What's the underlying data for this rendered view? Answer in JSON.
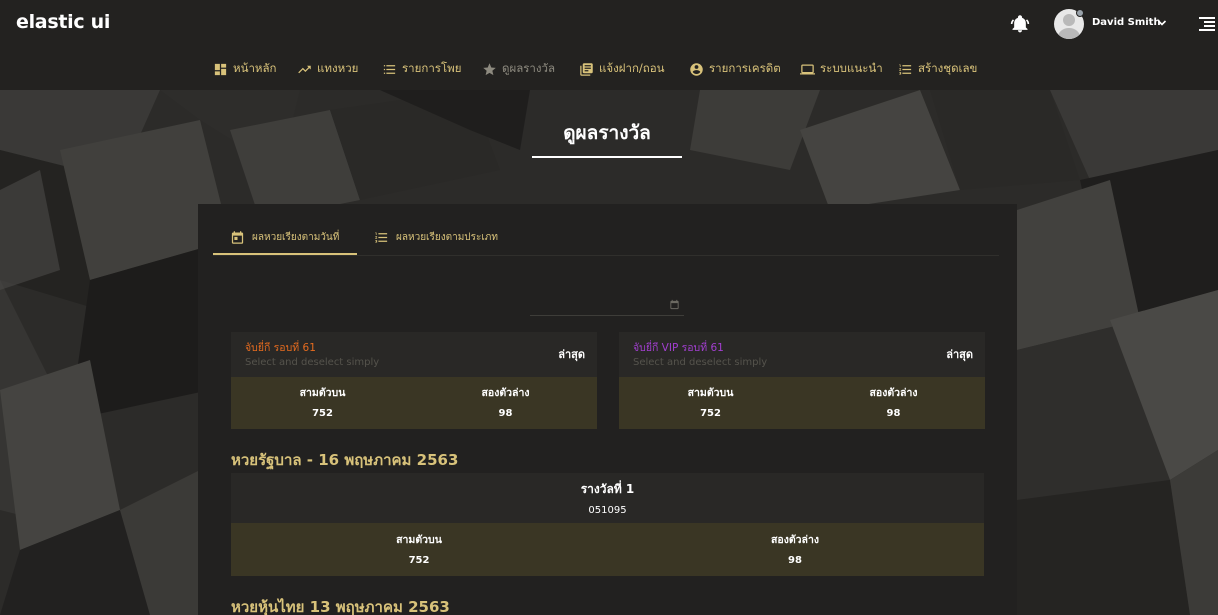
{
  "header": {
    "brand": "elastic ui",
    "user_name": "David Smith"
  },
  "nav": [
    {
      "label": "หน้าหลัก",
      "icon": "dashboard-icon"
    },
    {
      "label": "แทงหวย",
      "icon": "trending-up-icon"
    },
    {
      "label": "รายการโพย",
      "icon": "list-icon"
    },
    {
      "label": "ดูผลรางวัล",
      "icon": "star-icon",
      "active": true
    },
    {
      "label": "แจ้งฝาก/ถอน",
      "icon": "library-books-icon"
    },
    {
      "label": "รายการเครดิต",
      "icon": "account-circle-icon"
    },
    {
      "label": "ระบบแนะนำ",
      "icon": "laptop-icon"
    },
    {
      "label": "สร้างชุดเลข",
      "icon": "format-list-icon"
    }
  ],
  "page_title": "ดูผลรางวัล",
  "tabs": [
    {
      "label": "ผลหวยเรียงตามวันที่",
      "icon": "calendar-icon",
      "active": true
    },
    {
      "label": "ผลหวยเรียงตามประเภท",
      "icon": "list-numbered-icon"
    }
  ],
  "date_field": {
    "value": ""
  },
  "rounds": [
    {
      "title": "จับยี่กี รอบที่ 61",
      "subtitle": "Select and deselect simply",
      "latest": "ล่าสุด",
      "title_color": "#e56b1f",
      "cols": [
        {
          "label": "สามตัวบน",
          "value": "752"
        },
        {
          "label": "สองตัวล่าง",
          "value": "98"
        }
      ]
    },
    {
      "title": "จับยี่กี VIP รอบที่ 61",
      "subtitle": "Select and deselect simply",
      "latest": "ล่าสุด",
      "title_color": "#a23fd0",
      "cols": [
        {
          "label": "สามตัวบน",
          "value": "752"
        },
        {
          "label": "สองตัวล่าง",
          "value": "98"
        }
      ]
    }
  ],
  "government": {
    "title": "หวยรัฐบาล - 16 พฤษภาคม 2563",
    "prize_label": "รางวัลที่ 1",
    "prize_number": "051095",
    "cols": [
      {
        "label": "สามตัวบน",
        "value": "752"
      },
      {
        "label": "สองตัวล่าง",
        "value": "98"
      }
    ]
  },
  "thai_stock": {
    "title": "หวยหุ้นไทย 13 พฤษภาคม 2563"
  },
  "colors": {
    "accent": "#d8c27a",
    "header_bg": "#232220",
    "panel_bg": "#222120",
    "band_bg": "#3a3624"
  }
}
